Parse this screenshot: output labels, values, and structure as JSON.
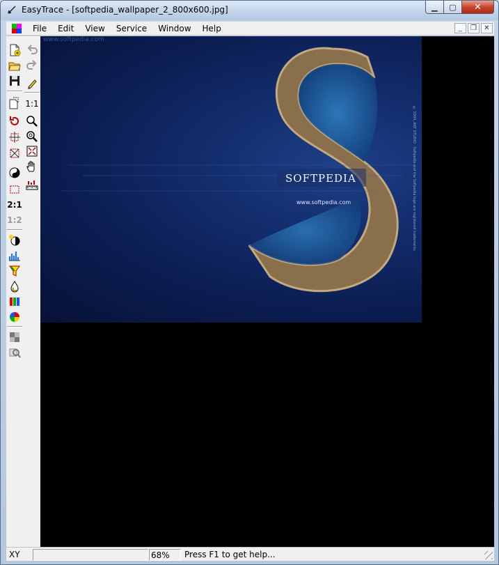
{
  "window": {
    "title": "EasyTrace - [softpedia_wallpaper_2_800x600.jpg]"
  },
  "menu": [
    "File",
    "Edit",
    "View",
    "Service",
    "Window",
    "Help"
  ],
  "toolbar": {
    "left": [
      "new-document-icon",
      "open-folder-icon",
      "save-disk-icon",
      "page-setup-icon",
      "rotate-icon",
      "crop-icon",
      "transform-icon",
      "yin-yang-icon",
      "selection-rect-icon",
      "zoom-2-1",
      "zoom-1-2",
      "brightness-icon",
      "histogram-icon",
      "filter-icon",
      "drop-icon",
      "color-bars-icon",
      "color-wheel-icon",
      "grid-icon",
      "magnifier-table-icon"
    ],
    "right": [
      "undo-icon",
      "redo-icon",
      "pencil-icon",
      "zoom-1-1",
      "zoom-in-icon",
      "zoom-out-icon",
      "fit-window-icon",
      "hand-pan-icon",
      "ruler-icon"
    ],
    "zoom_2_1": "2:1",
    "zoom_1_2": "1:2",
    "zoom_1_1": "1:1"
  },
  "image": {
    "logo": "SOFTPEDIA",
    "url": "www.softpedia.com",
    "faint_header": "www.softpedia.com",
    "side_note": "© 2004, ART STUDIO · Softpedia and the Softpedia logo are registered trademarks"
  },
  "status": {
    "xy_label": "XY",
    "coords": "",
    "zoom": "68%",
    "help": "Press F1 to get help..."
  },
  "colors": {
    "image_bg": "#0a1b4d",
    "viewport_bg": "#000000",
    "chrome": "#f0f0f0"
  }
}
